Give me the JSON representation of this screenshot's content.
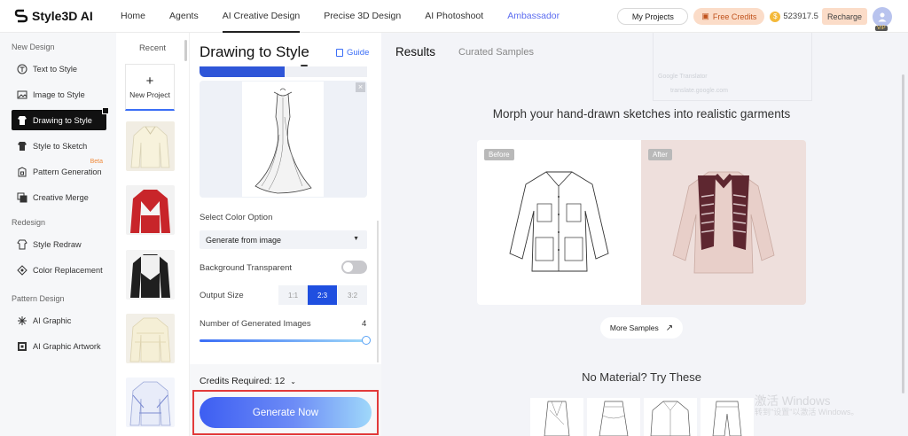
{
  "app": {
    "logo_text": "Style3D AI"
  },
  "nav": {
    "items": [
      "Home",
      "Agents",
      "AI Creative Design",
      "Precise 3D Design",
      "AI Photoshoot",
      "Ambassador"
    ],
    "active": "AI Creative Design"
  },
  "header": {
    "my_projects": "My Projects",
    "free_credits": "Free Credits",
    "balance": "523917.5",
    "recharge": "Recharge",
    "vip": "VIP"
  },
  "sidebar": {
    "sections": [
      {
        "title": "New Design",
        "items": [
          {
            "label": "Text to Style",
            "icon": "text-style-icon"
          },
          {
            "label": "Image to Style",
            "icon": "image-style-icon"
          },
          {
            "label": "Drawing to Style",
            "icon": "drawing-style-icon",
            "active": true
          },
          {
            "label": "Style to Sketch",
            "icon": "sketch-icon"
          },
          {
            "label": "Pattern Generation",
            "icon": "pattern-icon",
            "badge": "Beta"
          },
          {
            "label": "Creative Merge",
            "icon": "merge-icon"
          }
        ]
      },
      {
        "title": "Redesign",
        "items": [
          {
            "label": "Style Redraw",
            "icon": "redraw-icon"
          },
          {
            "label": "Color Replacement",
            "icon": "color-replace-icon"
          }
        ]
      },
      {
        "title": "Pattern Design",
        "items": [
          {
            "label": "AI Graphic",
            "icon": "graphic-icon"
          },
          {
            "label": "AI Graphic Artwork",
            "icon": "artwork-icon"
          }
        ]
      }
    ]
  },
  "recent": {
    "title": "Recent",
    "new_project": "New Project"
  },
  "panel": {
    "title": "Drawing to Style",
    "guide": "Guide",
    "color_option_label": "Select Color Option",
    "color_option_value": "Generate from image",
    "bg_transparent_label": "Background Transparent",
    "bg_transparent_on": false,
    "output_size_label": "Output Size",
    "output_sizes": [
      "1:1",
      "2:3",
      "3:2"
    ],
    "output_size_selected": "2:3",
    "num_images_label": "Number of Generated Images",
    "num_images_value": "4",
    "credits_required": "Credits Required: 12",
    "generate_button": "Generate Now"
  },
  "results": {
    "tabs": [
      "Results",
      "Curated Samples"
    ],
    "ghost_line1": "Google Translator",
    "ghost_line2": "translate.google.com",
    "headline": "Morph your hand-drawn sketches into realistic garments",
    "before_tag": "Before",
    "after_tag": "After",
    "more_samples": "More Samples",
    "no_material": "No Material? Try These"
  },
  "watermark": {
    "line1": "激活 Windows",
    "line2": "转到\"设置\"以激活 Windows。"
  },
  "colors": {
    "accent": "#3b6ef6",
    "primary_dark": "#111111",
    "highlight": "#e23a3a",
    "credits_bg": "#fbdcc8"
  }
}
